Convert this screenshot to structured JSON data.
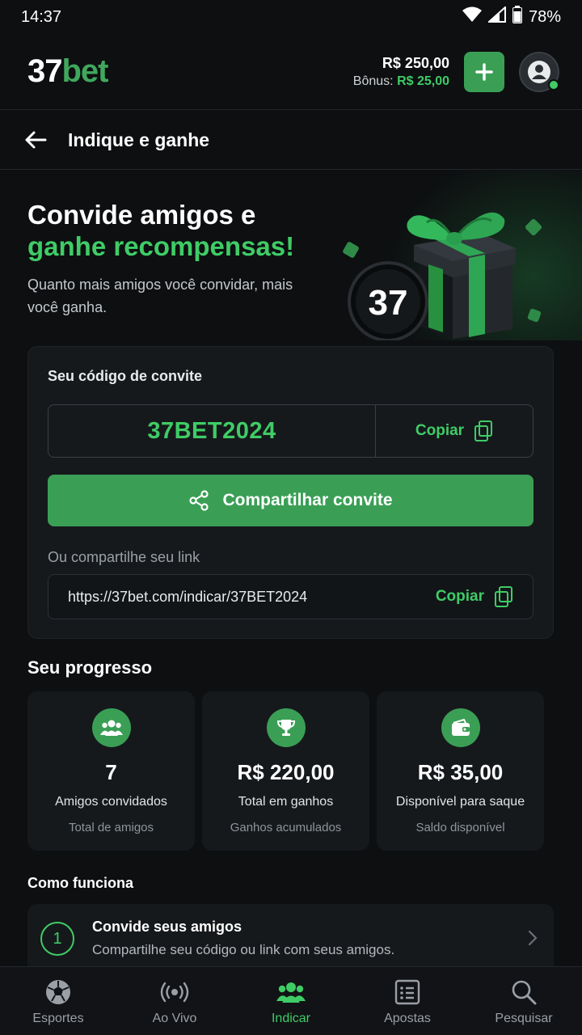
{
  "status_bar": {
    "time": "14:37",
    "battery": "78%"
  },
  "header": {
    "logo_num": "37",
    "logo_bet": "bet",
    "balance": "R$ 250,00",
    "bonus_label": "Bônus:",
    "bonus_value": "R$ 25,00"
  },
  "page": {
    "title": "Indique e ganhe"
  },
  "hero": {
    "title_line1": "Convide amigos e",
    "title_line2": "ganhe recompensas!",
    "subtitle": "Quanto mais amigos você convidar, mais você ganha.",
    "badge": "37"
  },
  "invite": {
    "label": "Seu código de convite",
    "code": "37BET2024",
    "copy_label": "Copiar",
    "share_label": "Compartilhar convite",
    "or_label": "Ou compartilhe seu link",
    "link": "https://37bet.com/indicar/37BET2024",
    "link_copy_label": "Copiar"
  },
  "progress": {
    "title": "Seu progresso",
    "stats": [
      {
        "icon": "users-icon",
        "value": "7",
        "label": "Amigos convidados",
        "sub": "Total de amigos"
      },
      {
        "icon": "trophy-icon",
        "value": "R$ 220,00",
        "label": "Total em ganhos",
        "sub": "Ganhos acumulados"
      },
      {
        "icon": "wallet-icon",
        "value": "R$ 35,00",
        "label": "Disponível para saque",
        "sub": "Saldo disponível"
      }
    ]
  },
  "how": {
    "title": "Como funciona",
    "steps": [
      {
        "num": "1",
        "title": "Convide seus amigos",
        "desc": "Compartilhe seu código ou link com seus amigos."
      }
    ]
  },
  "nav": [
    {
      "label": "Esportes",
      "icon": "soccer-ball-icon"
    },
    {
      "label": "Ao Vivo",
      "icon": "live-broadcast-icon"
    },
    {
      "label": "Indicar",
      "icon": "users-icon",
      "active": true
    },
    {
      "label": "Apostas",
      "icon": "bet-slip-icon"
    },
    {
      "label": "Pesquisar",
      "icon": "search-icon"
    }
  ],
  "colors": {
    "accent": "#3fcc66",
    "button": "#3a9f55",
    "background": "#0d0f11",
    "card": "#16191c"
  }
}
